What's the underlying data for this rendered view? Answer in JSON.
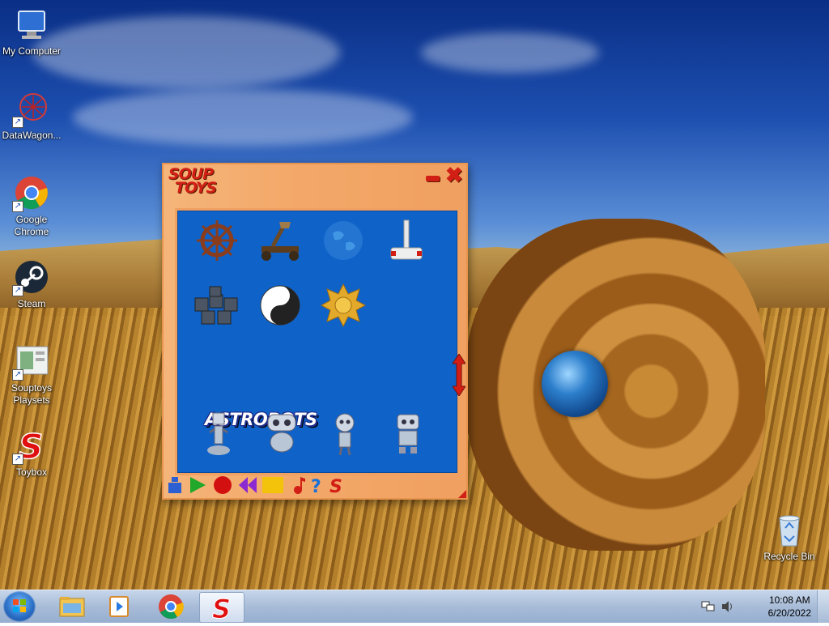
{
  "desktop": {
    "icons": [
      {
        "label": "My Computer",
        "icon": "computer-icon"
      },
      {
        "label": "DataWagon...",
        "icon": "datawagon-icon"
      },
      {
        "label": "Google Chrome",
        "icon": "chrome-icon"
      },
      {
        "label": "Steam",
        "icon": "steam-icon"
      },
      {
        "label": "Souptoys Playsets",
        "icon": "playsets-icon"
      },
      {
        "label": "Toybox",
        "icon": "toybox-icon"
      },
      {
        "label": "Recycle Bin",
        "icon": "recycle-bin-icon"
      }
    ]
  },
  "soup_window": {
    "logo_line1": "SOUP",
    "logo_line2": "TOYS",
    "section_label": "ASTROBOTS",
    "toys_row1": [
      "ship-wheel-icon",
      "catapult-icon",
      "globe-icon",
      "mallet-icon"
    ],
    "toys_row2": [
      "buckets-icon",
      "yin-yang-icon",
      "gold-gear-icon"
    ],
    "astrobots": [
      "astrobot-1-icon",
      "astrobot-2-icon",
      "astrobot-3-icon",
      "astrobot-4-icon"
    ],
    "toolbar": [
      "robot-tool-icon",
      "play-icon",
      "record-icon",
      "rewind-icon",
      "stop-icon",
      "music-icon",
      "help-icon",
      "soup-s-icon"
    ],
    "colors": {
      "frame": "#f3a96a",
      "panel": "#0f62c8",
      "accent_red": "#d21f16"
    }
  },
  "taskbar": {
    "apps": [
      "explorer-icon",
      "media-player-icon",
      "chrome-icon",
      "souptoys-icon"
    ],
    "clock_time": "10:08 AM",
    "clock_date": "6/20/2022"
  }
}
